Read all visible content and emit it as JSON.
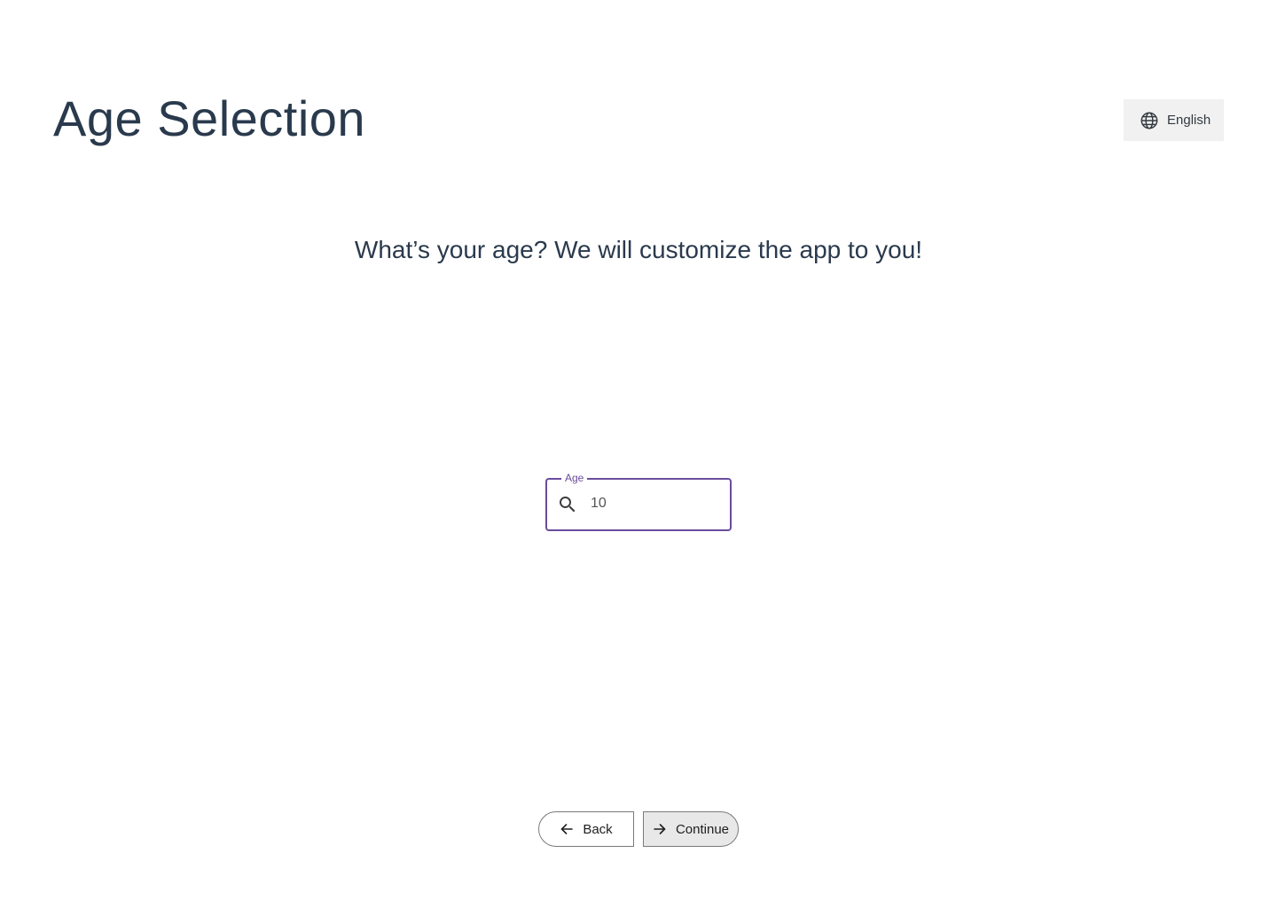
{
  "header": {
    "title": "Age Selection",
    "language_label": "English",
    "language_icon": "globe-icon"
  },
  "main": {
    "prompt": "What’s your age? We will customize the app to you!",
    "age_field": {
      "label": "Age",
      "value": "10",
      "icon": "search-icon"
    }
  },
  "footer": {
    "back_label": "Back",
    "back_icon": "arrow-left-icon",
    "continue_label": "Continue",
    "continue_icon": "arrow-right-icon"
  },
  "colors": {
    "heading": "#2a3a4d",
    "accent": "#6a4c9c",
    "language_button_bg": "#f1f1f1",
    "continue_button_bg": "#e8e8e8"
  }
}
